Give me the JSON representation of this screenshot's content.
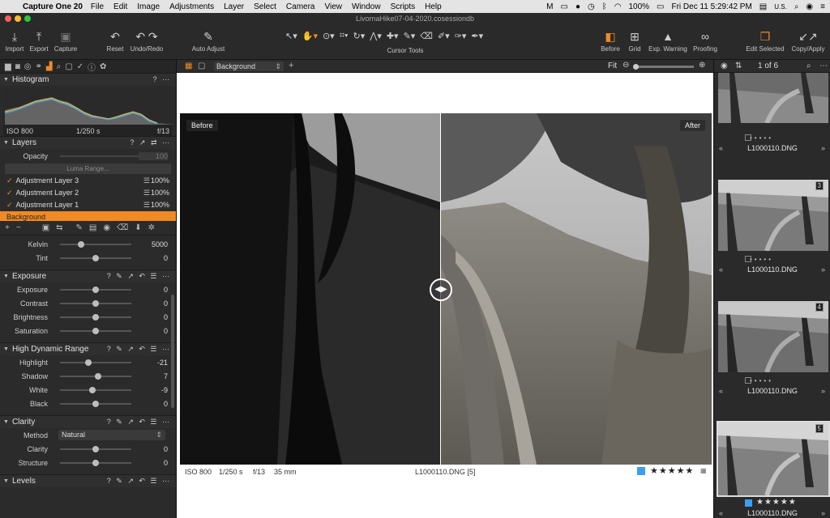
{
  "menubar": {
    "app": "Capture One 20",
    "menus": [
      "File",
      "Edit",
      "Image",
      "Adjustments",
      "Layer",
      "Select",
      "Camera",
      "View",
      "Window",
      "Scripts",
      "Help"
    ],
    "battery": "100%",
    "datetime": "Fri Dec 11  5:29:42 PM",
    "input": "U.S."
  },
  "window": {
    "title": "LivornaHike07-04-2020.cosessiondb"
  },
  "toolbar": {
    "import": "Import",
    "export": "Export",
    "capture": "Capture",
    "reset": "Reset",
    "undo_redo": "Undo/Redo",
    "auto_adjust": "Auto Adjust",
    "cursor_tools": "Cursor Tools",
    "before": "Before",
    "grid": "Grid",
    "exp_warning": "Exp. Warning",
    "proofing": "Proofing",
    "edit_selected": "Edit Selected",
    "copy_apply": "Copy/Apply"
  },
  "histogram": {
    "title": "Histogram",
    "iso": "ISO 800",
    "shutter": "1/250 s",
    "aperture": "f/13"
  },
  "layers": {
    "title": "Layers",
    "opacity_label": "Opacity",
    "opacity_value": "100",
    "luma_range": "Luma Range...",
    "items": [
      {
        "name": "Adjustment Layer 3",
        "value": "100%"
      },
      {
        "name": "Adjustment Layer 2",
        "value": "100%"
      },
      {
        "name": "Adjustment Layer 1",
        "value": "100%"
      }
    ],
    "selected": "Background"
  },
  "wb": {
    "kelvin_label": "Kelvin",
    "kelvin_value": "5000",
    "kelvin_level": 0.3,
    "tint_label": "Tint",
    "tint_value": "0",
    "tint_level": 0.5
  },
  "exposure": {
    "title": "Exposure",
    "rows": [
      {
        "label": "Exposure",
        "value": "0",
        "level": 0.5
      },
      {
        "label": "Contrast",
        "value": "0",
        "level": 0.5
      },
      {
        "label": "Brightness",
        "value": "0",
        "level": 0.5
      },
      {
        "label": "Saturation",
        "value": "0",
        "level": 0.5
      }
    ]
  },
  "hdr": {
    "title": "High Dynamic Range",
    "rows": [
      {
        "label": "Highlight",
        "value": "-21",
        "level": 0.4
      },
      {
        "label": "Shadow",
        "value": "7",
        "level": 0.53
      },
      {
        "label": "White",
        "value": "-9",
        "level": 0.45
      },
      {
        "label": "Black",
        "value": "0",
        "level": 0.5
      }
    ]
  },
  "clarity": {
    "title": "Clarity",
    "method_label": "Method",
    "method_value": "Natural",
    "rows": [
      {
        "label": "Clarity",
        "value": "0",
        "level": 0.5
      },
      {
        "label": "Structure",
        "value": "0",
        "level": 0.5
      }
    ]
  },
  "levels": {
    "title": "Levels"
  },
  "viewer": {
    "variant": "Background",
    "fit": "Fit",
    "before_label": "Before",
    "after_label": "After",
    "info": {
      "iso": "ISO 800",
      "shutter": "1/250 s",
      "aperture": "f/13",
      "focal": "35 mm",
      "file": "L1000110.DNG [5]"
    }
  },
  "browser": {
    "counter": "1 of 6",
    "thumbs": [
      {
        "name": "L1000110.DNG",
        "badge": ""
      },
      {
        "name": "L1000110.DNG",
        "badge": "3"
      },
      {
        "name": "L1000110.DNG",
        "badge": "4"
      },
      {
        "name": "L1000110.DNG",
        "badge": "5"
      }
    ]
  },
  "colors": {
    "accent": "#f08a24",
    "blue_tag": "#3b9ff0"
  }
}
